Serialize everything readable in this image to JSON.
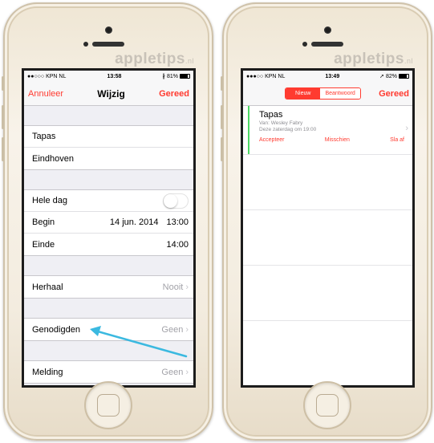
{
  "watermark": {
    "text": "appletips",
    "tld": ".nl"
  },
  "left_phone": {
    "status": {
      "carrier": "●●○○○ KPN NL",
      "time": "13:58",
      "battery": "81%",
      "battery_level": 0.81
    },
    "nav": {
      "cancel": "Annuleer",
      "title": "Wijzig",
      "done": "Gereed"
    },
    "event": {
      "title": "Tapas",
      "location": "Eindhoven"
    },
    "all_day": {
      "label": "Hele dag",
      "on": false
    },
    "start": {
      "label": "Begin",
      "date": "14 jun. 2014",
      "time": "13:00"
    },
    "end": {
      "label": "Einde",
      "time": "14:00"
    },
    "repeat": {
      "label": "Herhaal",
      "value": "Nooit"
    },
    "invitees": {
      "label": "Genodigden",
      "value": "Geen"
    },
    "alert": {
      "label": "Melding",
      "value": "Geen"
    },
    "highlight_color": "#3bb9e0"
  },
  "right_phone": {
    "status": {
      "carrier": "●●●○○ KPN NL",
      "time": "13:49",
      "battery": "82%",
      "battery_level": 0.82
    },
    "segments": [
      "Nieuw",
      "Beantwoord"
    ],
    "done": "Gereed",
    "invite": {
      "title": "Tapas",
      "from": "Van: Wesley Fabry",
      "when": "Deze zaterdag om 19:00",
      "accept": "Accepteer",
      "maybe": "Misschien",
      "decline": "Sla af"
    }
  },
  "colors": {
    "accent": "#ff3b30",
    "calendar_bar": "#4cd964"
  }
}
